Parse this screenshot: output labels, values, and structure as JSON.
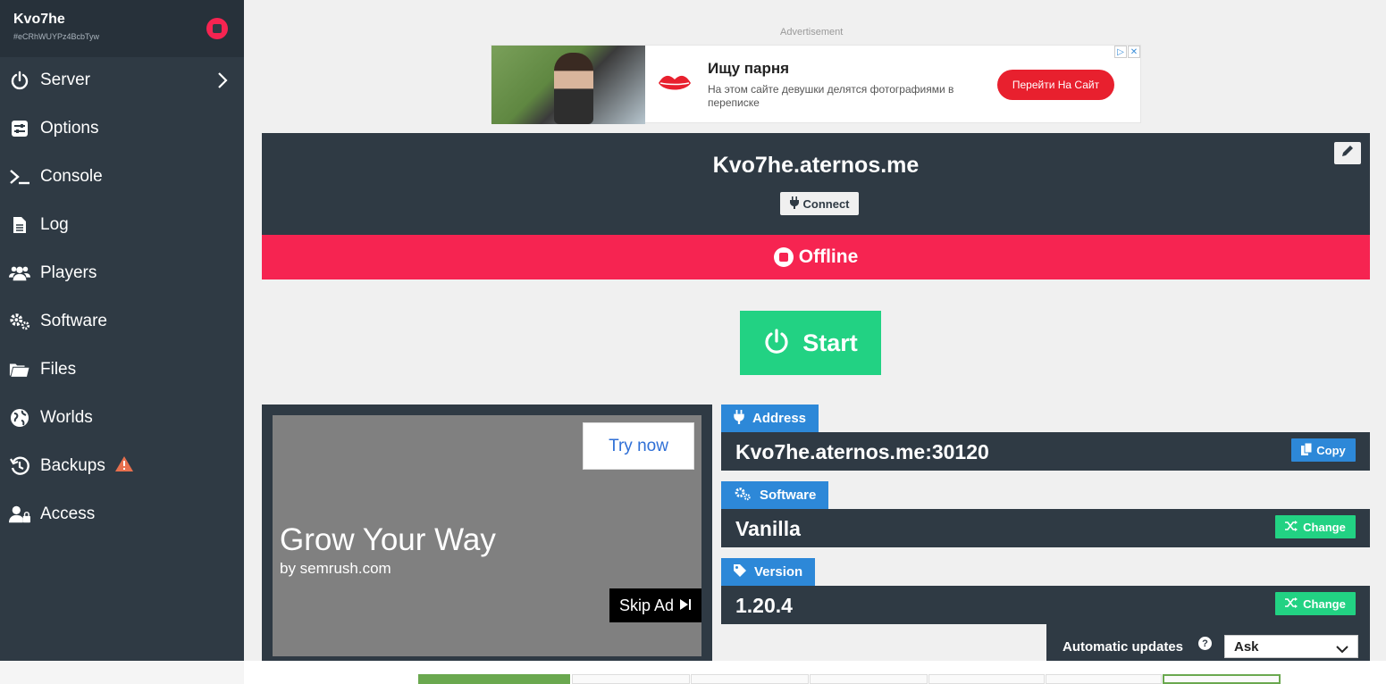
{
  "sidebar": {
    "server_name": "Kvo7he",
    "server_id": "#eCRhWUYPz4BcbTyw",
    "items": [
      {
        "label": "Server",
        "icon": "power-icon"
      },
      {
        "label": "Options",
        "icon": "sliders-icon"
      },
      {
        "label": "Console",
        "icon": "terminal-icon"
      },
      {
        "label": "Log",
        "icon": "file-icon"
      },
      {
        "label": "Players",
        "icon": "users-icon"
      },
      {
        "label": "Software",
        "icon": "gears-icon"
      },
      {
        "label": "Files",
        "icon": "folder-icon"
      },
      {
        "label": "Worlds",
        "icon": "globe-icon"
      },
      {
        "label": "Backups",
        "icon": "history-icon"
      },
      {
        "label": "Access",
        "icon": "user-lock-icon"
      }
    ]
  },
  "ad_top": {
    "label": "Advertisement",
    "heading": "Ищу парня",
    "text": "На этом сайте девушки делятся фотографиями в переписке",
    "button": "Перейти На Сайт"
  },
  "server": {
    "address_title": "Kvo7he.aternos.me",
    "connect_label": "Connect",
    "status": "Offline",
    "status_color": "#f62451",
    "start_label": "Start",
    "start_color": "#22d283"
  },
  "video_ad": {
    "cta": "Try now",
    "headline": "Grow Your Way",
    "byline": "by semrush.com",
    "skip": "Skip Ad"
  },
  "info": {
    "address": {
      "tag": "Address",
      "value": "Kvo7he.aternos.me:30120",
      "button": "Copy"
    },
    "software": {
      "tag": "Software",
      "value": "Vanilla",
      "button": "Change"
    },
    "version": {
      "tag": "Version",
      "value": "1.20.4",
      "button": "Change"
    },
    "auto_updates": {
      "label": "Automatic updates",
      "help": "?",
      "selected": "Ask"
    }
  },
  "colors": {
    "accent_blue": "#2d88d8",
    "sidebar": "#2f3a44"
  }
}
